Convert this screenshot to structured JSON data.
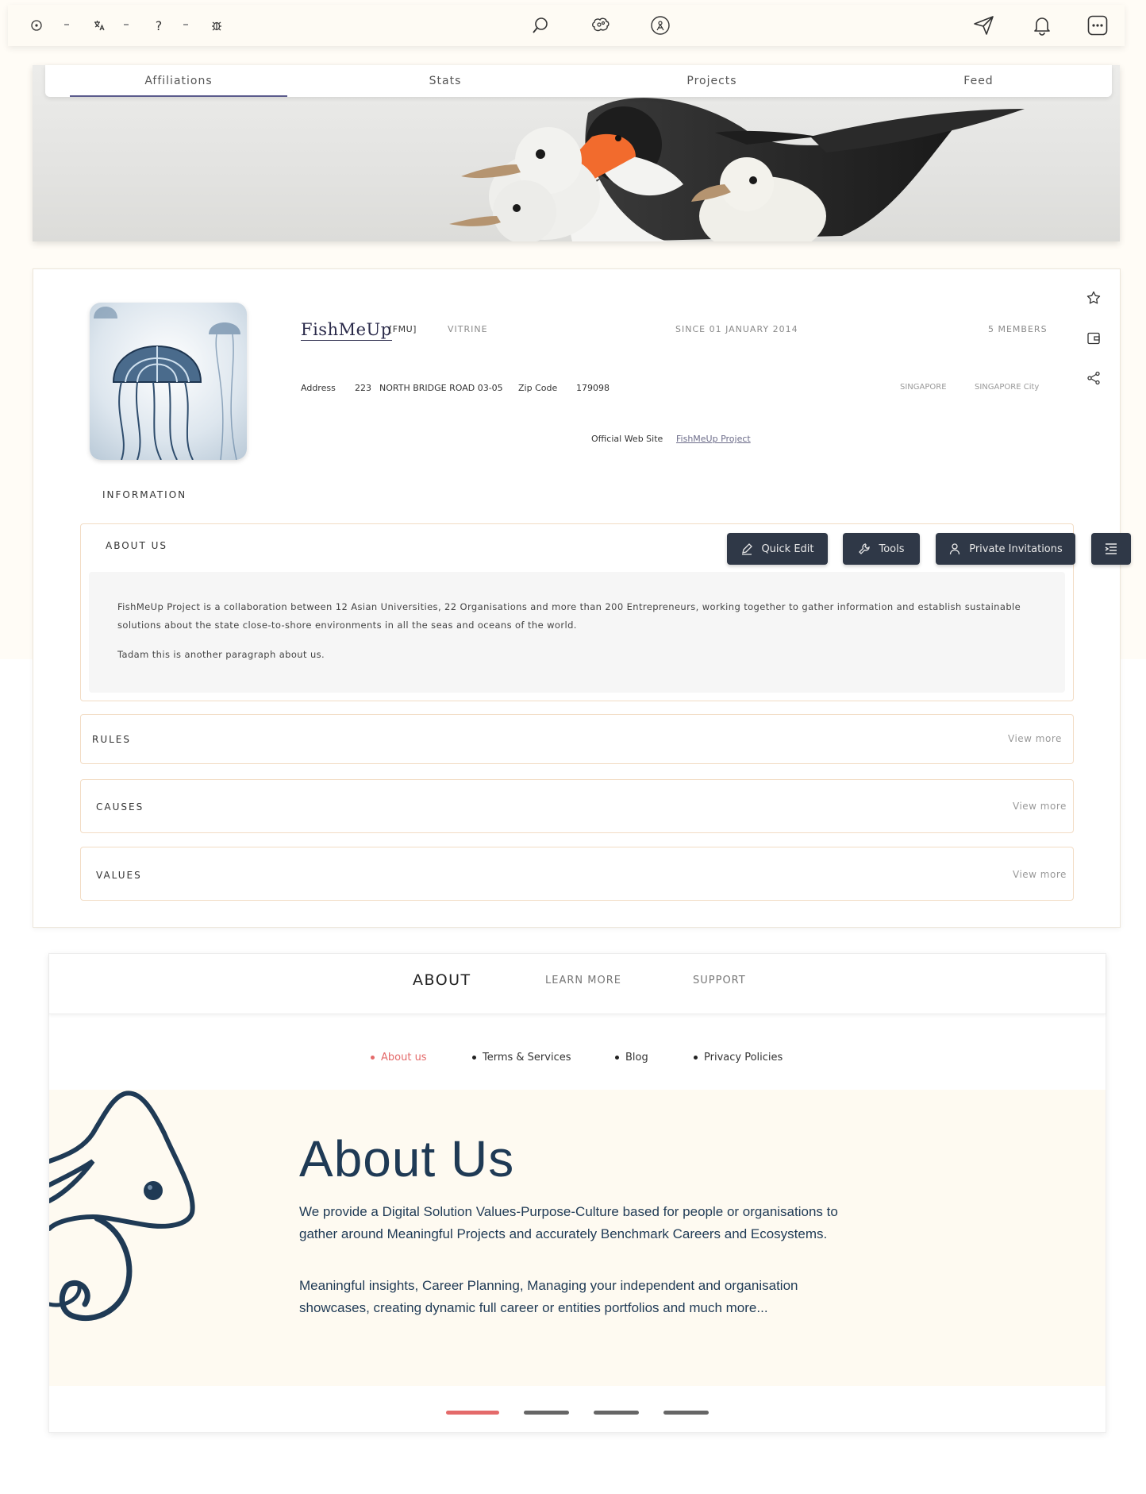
{
  "toolbar": {
    "left_icons": [
      "target-icon",
      "translate-icon",
      "help-icon",
      "bug-icon"
    ],
    "help_glyph": "?",
    "center_icons": [
      "search-icon",
      "brain-icon",
      "compass-icon"
    ],
    "right_icons": [
      "send-icon",
      "bell-icon",
      "more-icon"
    ]
  },
  "tabs": [
    {
      "label": "Affiliations",
      "active": true
    },
    {
      "label": "Stats",
      "active": false
    },
    {
      "label": "Projects",
      "active": false
    },
    {
      "label": "Feed",
      "active": false
    }
  ],
  "org": {
    "name": "FishMeUp",
    "abbr": "[FMU]",
    "type": "VITRINE",
    "since": "SINCE 01 JANUARY 2014",
    "members": "5 MEMBERS",
    "address_label": "Address",
    "address_number": "223",
    "address_street": "NORTH BRIDGE ROAD 03-05",
    "zip_label": "Zip Code",
    "zip": "179098",
    "country": "SINGAPORE",
    "city": "SINGAPORE City",
    "website_label": "Official Web Site",
    "website_link": "FishMeUp Project"
  },
  "side_icons": [
    "star-icon",
    "wallet-icon",
    "share-icon"
  ],
  "information_label": "INFORMATION",
  "about": {
    "title": "ABOUT US",
    "paragraph1": "FishMeUp Project is a collaboration between 12 Asian Universities, 22 Organisations and more than 200 Entrepreneurs, working together to gather information and establish sustainable solutions about the state close-to-shore environments in all the seas and oceans of the world.",
    "paragraph2": "Tadam this is another paragraph about us."
  },
  "buttons": {
    "quick_edit": "Quick Edit",
    "tools": "Tools",
    "private_invitations": "Private Invitations"
  },
  "sections": [
    {
      "title": "RULES",
      "action": "View more"
    },
    {
      "title": "CAUSES",
      "action": "View more"
    },
    {
      "title": "VALUES",
      "action": "View more"
    }
  ],
  "footer": {
    "tabs": [
      "ABOUT",
      "LEARN MORE",
      "SUPPORT"
    ],
    "links": [
      "About us",
      "Terms & Services",
      "Blog",
      "Privacy Policies"
    ],
    "hero_title": "About Us",
    "hero_p1": "We provide a Digital Solution Values-Purpose-Culture based for people or organisations to gather around Meaningful Projects and accurately Benchmark Careers and Ecosystems.",
    "hero_p2": "Meaningful insights, Career Planning, Managing your independent and organisation showcases, creating dynamic full career or entities portfolios and much more...",
    "pager": {
      "count": 4,
      "active_index": 0
    },
    "colors": {
      "accent": "#e46a6a",
      "navy": "#1f3a55"
    }
  }
}
